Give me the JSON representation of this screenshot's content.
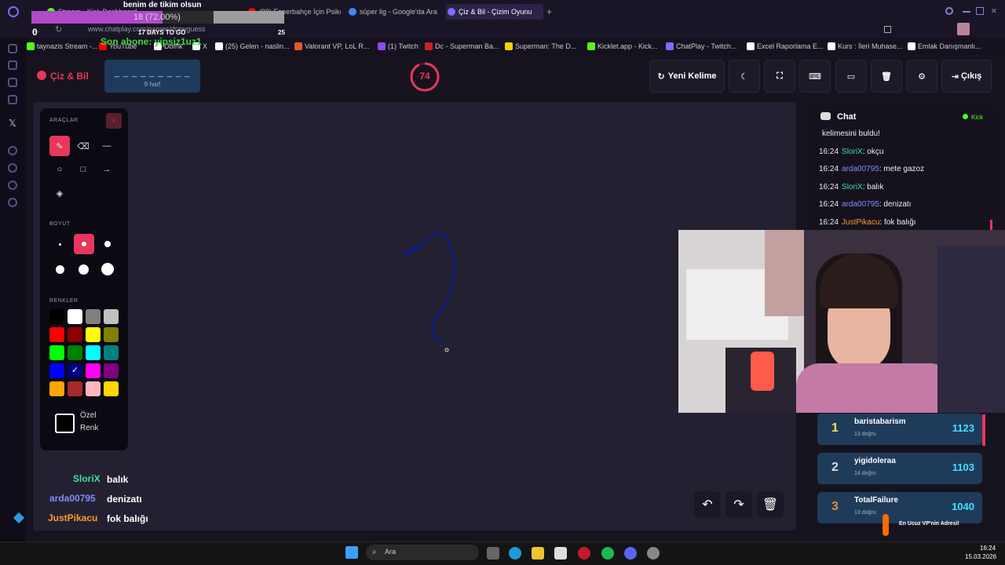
{
  "overlay": {
    "banner_text": "benim de tikim olsun",
    "progress_text": "18 (72.00%)",
    "progress_fraction": 0.72,
    "days_to_go": "17 DAYS TO GO",
    "counter_left": "0",
    "counter_right": "25",
    "son_abone": "Son abone: yipsiz1uz1"
  },
  "browser": {
    "tabs": [
      {
        "label": "Stream - Kick Dashboard",
        "color": "#53fc18"
      },
      {
        "label": "(99) Fenerbahçe İçin Psiko",
        "color": "#ff0000"
      },
      {
        "label": "süper lig - Google'da Ara",
        "color": "#4285f4"
      },
      {
        "label": "Çiz & Bil - Çizim Oyunu",
        "color": "#7b6cff"
      }
    ],
    "url": "www.chatplay.com/games/drawguess",
    "bookmarks": [
      {
        "label": "taynazis Stream -...",
        "color": "#53fc18"
      },
      {
        "label": "YouTube",
        "color": "#ff0000"
      },
      {
        "label": "Dofhk",
        "color": "#ffffff"
      },
      {
        "label": "X",
        "color": "#ffffff"
      },
      {
        "label": "(25) Gelen - naslin...",
        "color": "#ffffff"
      },
      {
        "label": "Valorant VP, LoL R...",
        "color": "#e8542c"
      },
      {
        "label": "(1) Twitch",
        "color": "#9146ff"
      },
      {
        "label": "Dc - Superman Ba...",
        "color": "#c22"
      },
      {
        "label": "Superman: The D...",
        "color": "#f5d300"
      },
      {
        "label": "Kicklet.app - Kick...",
        "color": "#53fc18"
      },
      {
        "label": "ChatPlay - Twitch...",
        "color": "#7b6cff"
      },
      {
        "label": "Excel Raporlama E...",
        "color": "#ffffff"
      },
      {
        "label": "Kurs : İleri Muhase...",
        "color": "#ffffff"
      },
      {
        "label": "Emlak Danışmanlı...",
        "color": "#ffffff"
      }
    ]
  },
  "game": {
    "logo": "Çiz & Bil",
    "word_mask": "_ _ _ _ _ _ _ _ _",
    "word_hint": "9 harf",
    "timer": "74",
    "timer_fraction": 0.93,
    "buttons": {
      "new_word": "Yeni Kelime",
      "exit": "Çıkış"
    },
    "tools_title": "ARAÇLAR",
    "size_title": "BOYUT",
    "colors_title": "RENKLER",
    "custom_color_1": "Özel",
    "custom_color_2": "Renk",
    "palette": [
      "#000000",
      "#ffffff",
      "#808080",
      "#c0c0c0",
      "#ff0000",
      "#8b0000",
      "#ffff00",
      "#808000",
      "#00ff00",
      "#008000",
      "#00ffff",
      "#008080",
      "#0000ff",
      "#000080",
      "#ff00ff",
      "#800080",
      "#ffa500",
      "#a52a2a",
      "#ffb6c1",
      "#ffd700"
    ],
    "selected_color": "#000080",
    "accent": "#e8365d"
  },
  "chat": {
    "title": "Chat",
    "source": "Kick",
    "lines": [
      {
        "time": "",
        "user": "",
        "msg": "kelimesini buldu!",
        "color": "#eeeeee"
      },
      {
        "time": "16:24",
        "user": "SloriX",
        "msg": ": okçu",
        "color": "#3ee09a"
      },
      {
        "time": "16:24",
        "user": "arda00795",
        "msg": ": mete gazoz",
        "color": "#7f8cff"
      },
      {
        "time": "16:24",
        "user": "SloriX",
        "msg": ": balık",
        "color": "#3ee09a"
      },
      {
        "time": "16:24",
        "user": "arda00795",
        "msg": ": denizatı",
        "color": "#7f8cff"
      },
      {
        "time": "16:24",
        "user": "JustPikacu",
        "msg": ": fok balığı",
        "color": "#ff9a2e"
      }
    ]
  },
  "leaderboard": [
    {
      "rank": "1",
      "name": "baristabarism",
      "correct": "13 doğru",
      "score": "1123",
      "rank_color": "#ffd84d"
    },
    {
      "rank": "2",
      "name": "yigidoleraa",
      "correct": "14 doğru",
      "score": "1103",
      "rank_color": "#d7dde5"
    },
    {
      "rank": "3",
      "name": "TotalFailure",
      "correct": "13 doğru",
      "score": "1040",
      "rank_color": "#e08c3c"
    }
  ],
  "overlay_chat": [
    {
      "user": "SloriX",
      "msg": "balık",
      "color": "#3ee09a"
    },
    {
      "user": "arda00795",
      "msg": "denizatı",
      "color": "#7f8cff"
    },
    {
      "user": "JustPikacu",
      "msg": "fok balığı",
      "color": "#ff9a2e"
    }
  ],
  "ad_text": "En Ucuz VP'nin Adresi!",
  "taskbar": {
    "search_placeholder": "Ara",
    "time": "16:24",
    "date": "15.03.2026"
  }
}
